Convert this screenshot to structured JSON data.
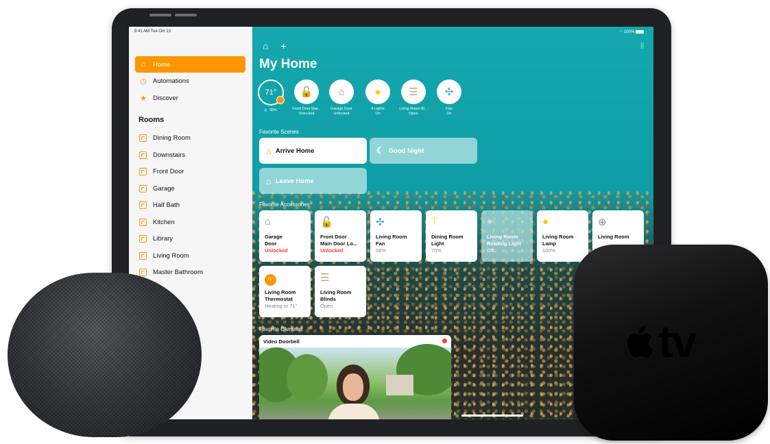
{
  "status_bar": {
    "time": "9:41 AM  Tue Oct 13",
    "battery": "100%"
  },
  "sidebar": {
    "items": [
      {
        "label": "Home",
        "icon": "house-icon",
        "selected": true
      },
      {
        "label": "Automations",
        "icon": "clock-icon"
      },
      {
        "label": "Discover",
        "icon": "star-icon"
      }
    ],
    "rooms_heading": "Rooms",
    "rooms": [
      "Dining Room",
      "Downstairs",
      "Front Door",
      "Garage",
      "Half Bath",
      "Kitchen",
      "Library",
      "Living Room",
      "Master Bathroom"
    ]
  },
  "main": {
    "title": "My Home",
    "status": [
      {
        "value": "71°",
        "sub": "30%"
      },
      {
        "label1": "Front Door Mai...",
        "label2": "Unlocked",
        "icon": "unlocked-padlock-icon"
      },
      {
        "label1": "Garage Door",
        "label2": "Unlocked",
        "icon": "garage-icon"
      },
      {
        "label1": "6 Lights",
        "label2": "On",
        "icon": "lightbulb-icon"
      },
      {
        "label1": "Living Room Bl...",
        "label2": "Open",
        "icon": "blinds-icon"
      },
      {
        "label1": "Fan",
        "label2": "On",
        "icon": "fan-icon"
      }
    ],
    "favorite_scenes_label": "Favorite Scenes",
    "scenes": [
      {
        "label": "Arrive Home",
        "active": true
      },
      {
        "label": "Good Night",
        "active": false
      },
      {
        "label": "Leave Home",
        "active": false
      }
    ],
    "favorite_accessories_label": "Favorite Accessories",
    "accessories": [
      {
        "name1": "Garage",
        "name2": "Door",
        "status": "Unlocked",
        "icon": "garage-icon"
      },
      {
        "name1": "Front Door",
        "name2": "Main Door Lo...",
        "status": "Unlocked",
        "icon": "unlocked-padlock-icon"
      },
      {
        "name1": "Living Room",
        "name2": "Fan",
        "status": "68%",
        "icon": "fan-icon"
      },
      {
        "name1": "Dining Room",
        "name2": "Light",
        "status": "70%",
        "icon": "floor-lamp-icon"
      },
      {
        "name1": "Living Room",
        "name2": "Reading Light",
        "status": "Off",
        "icon": "desk-lamp-icon"
      },
      {
        "name1": "Living Room",
        "name2": "Lamp",
        "status": "100%",
        "icon": "lightbulb-icon"
      },
      {
        "name1": "Living Room",
        "name2": "",
        "status": "",
        "icon": "sensor-icon"
      },
      {
        "name1": "Living Room",
        "name2": "Thermostat",
        "status": "Heating to 71°",
        "icon": "thermostat-icon",
        "badge": "71°"
      },
      {
        "name1": "Living Room",
        "name2": "Blinds",
        "status": "Open",
        "icon": "blinds-icon"
      }
    ],
    "favorite_cameras_label": "Favorite Cameras",
    "camera_title": "Video Doorbell"
  },
  "appletv_logo": "tv"
}
